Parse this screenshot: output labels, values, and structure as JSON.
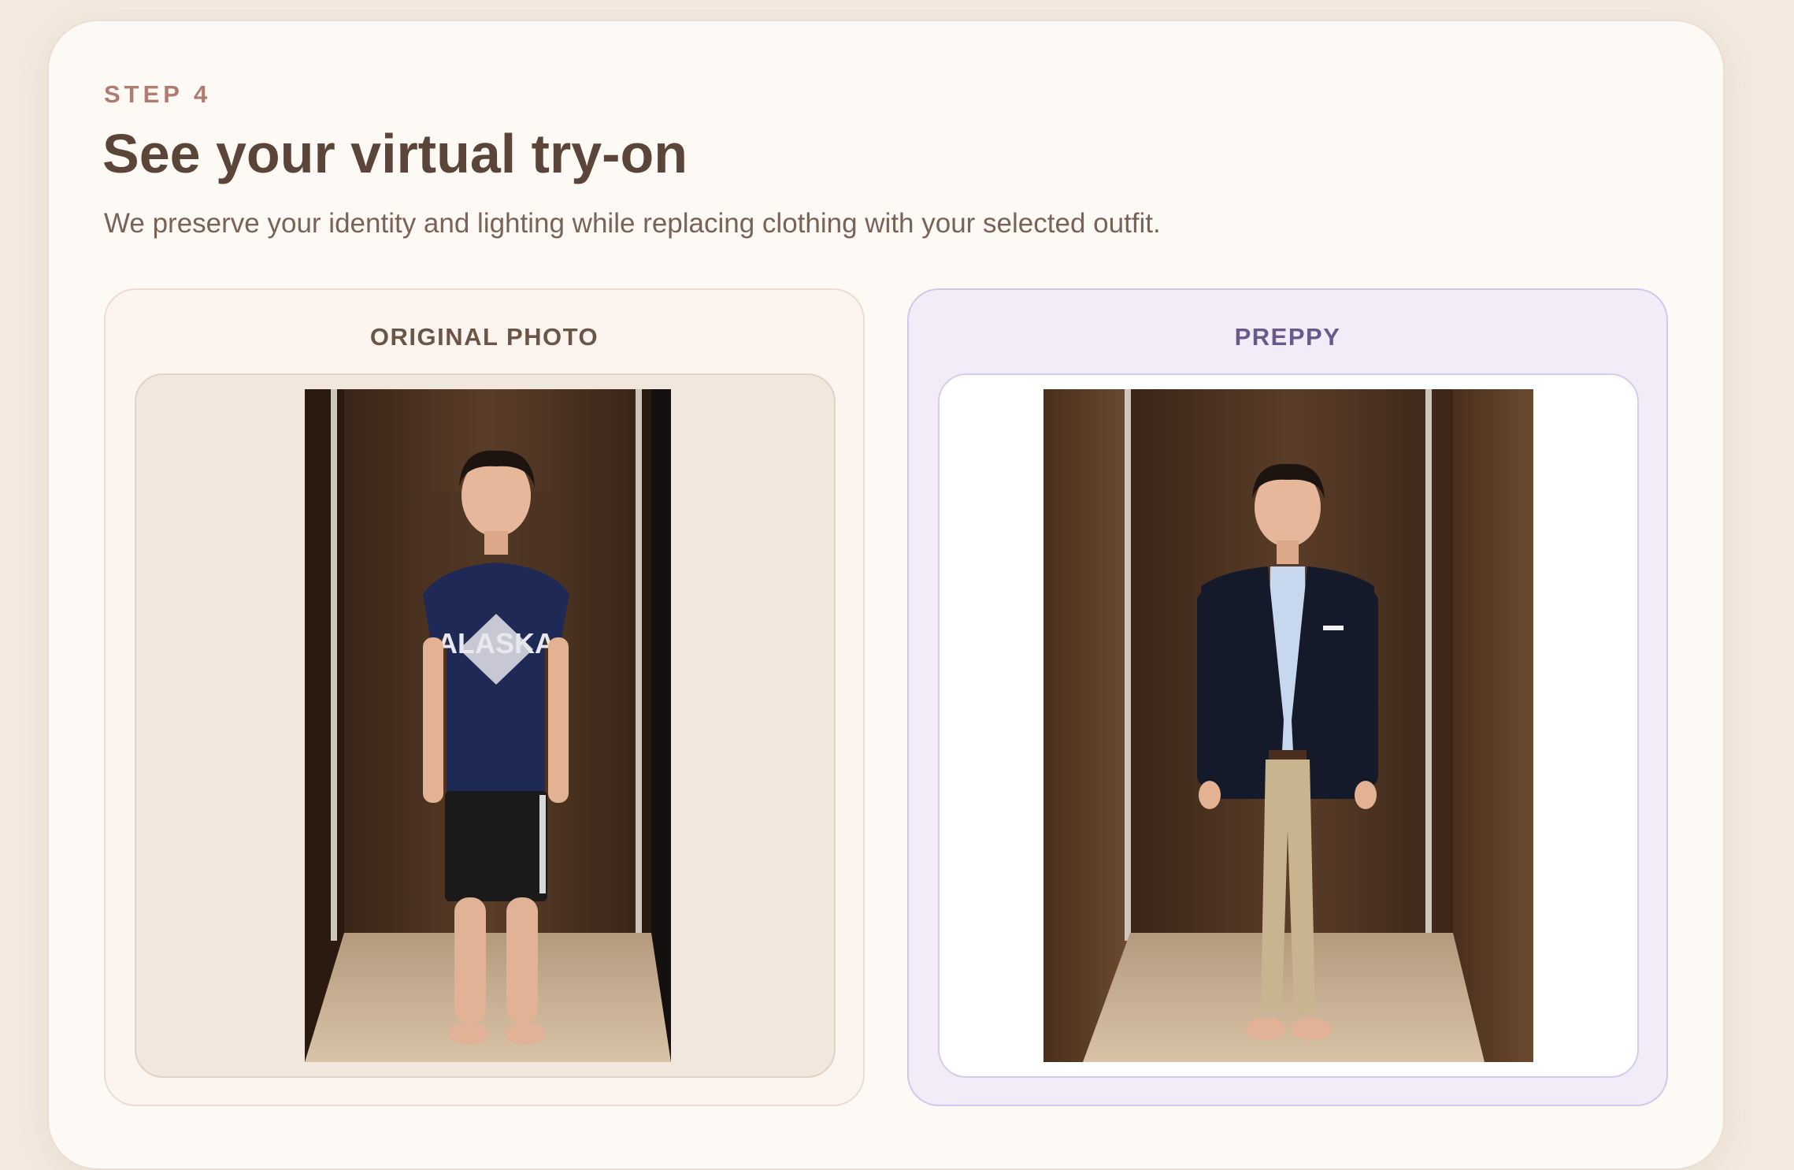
{
  "step_label": "STEP 4",
  "title": "See your virtual try-on",
  "subtitle": "We preserve your identity and lighting while replacing clothing with your selected outfit.",
  "panels": [
    {
      "label": "ORIGINAL PHOTO",
      "image_alt": "Person standing in a wood-paneled booth wearing a navy ALASKA t-shirt and black shorts",
      "shirt_text": "ALASKA"
    },
    {
      "label": "PREPPY",
      "image_alt": "Same person wearing a navy blazer, light blue shirt, brown belt and khaki chinos"
    }
  ],
  "colors": {
    "page_background": "#f3e9df",
    "card_background": "#fdf9f4",
    "step_label": "#b07c72",
    "title": "#5a4538",
    "original_panel": "#fcf4ee",
    "preppy_panel": "#f2ecf8",
    "preppy_label": "#6a5a8a"
  }
}
